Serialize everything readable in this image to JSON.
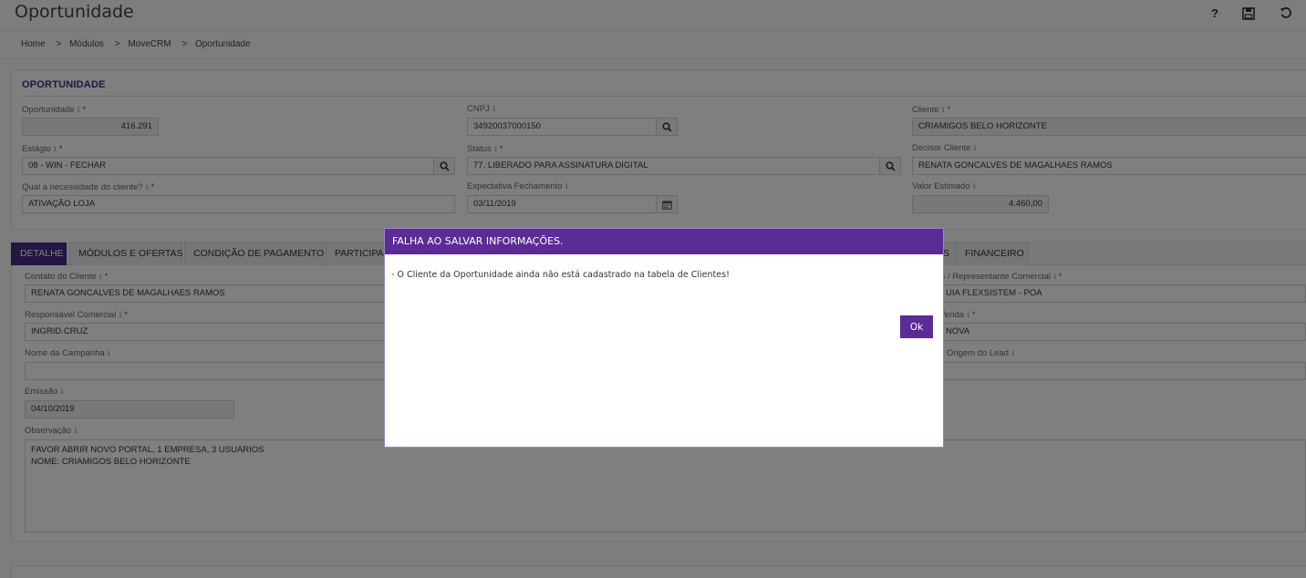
{
  "header": {
    "title": "Oportunidade",
    "help_label": "?"
  },
  "breadcrumb": {
    "items": [
      "Home",
      "Módulos",
      "MoveCRM",
      "Oportunidade"
    ],
    "separator": ">"
  },
  "section": {
    "title": "OPORTUNIDADE"
  },
  "info_glyph": "ℹ",
  "required_glyph": "*",
  "fields": {
    "oportunidade": {
      "label": "Oportunidade",
      "value": "416.291"
    },
    "cnpj": {
      "label": "CNPJ",
      "value": "34920037000150"
    },
    "cliente": {
      "label": "Cliente",
      "value": "CRIAMIGOS BELO HORIZONTE"
    },
    "estagio": {
      "label": "Estágio",
      "value": "08 - WIN - FECHAR"
    },
    "status": {
      "label": "Status",
      "value": "77. LIBERADO PARA ASSINATURA DIGITAL"
    },
    "decisor": {
      "label": "Decisor Cliente",
      "value": "RENATA GONCALVES DE MAGALHAES RAMOS"
    },
    "necessidade": {
      "label": "Qual a necessidade do cliente?",
      "value": "ATIVAÇÃO LOJA"
    },
    "expectativa": {
      "label": "Expectativa Fechamento",
      "value": "03/11/2019"
    },
    "valor": {
      "label": "Valor Estimado",
      "value": "4.460,00"
    }
  },
  "tabs": [
    {
      "label": "DETALHE"
    },
    {
      "label": "MÓDULOS E OFERTAS"
    },
    {
      "label": "CONDIÇÃO DE PAGAMENTO"
    },
    {
      "label": "PARTICIPAN"
    },
    {
      "label": "S"
    },
    {
      "label": "FINANCEIRO"
    }
  ],
  "detail": {
    "contato": {
      "label": "Contato do Cliente",
      "value": "RENATA GONCALVES DE MAGALHAES RAMOS"
    },
    "representante": {
      "label": "S / Representante Comercial",
      "value": "UIA FLEXSISTEM - POA"
    },
    "responsavel": {
      "label": "Responsável Comercial",
      "value": "INGRID.CRUZ"
    },
    "venda": {
      "label": "Venda",
      "value": "NOVA"
    },
    "campanha": {
      "label": "Nome da Campanha",
      "value": ""
    },
    "origem": {
      "label": "e Origem do Lead",
      "value": ""
    },
    "emissao": {
      "label": "Emissão",
      "value": "04/10/2019"
    },
    "observacao": {
      "label": "Observação",
      "value": "FAVOR ABRIR NOVO PORTAL, 1 EMPRESA, 3 USUARIOS\nNOME: CRIAMIGOS BELO HORIZONTE"
    }
  },
  "modal": {
    "title": "FALHA AO SALVAR INFORMAÇÕES.",
    "message": "- O Cliente da Oportunidade ainda não está cadastrado na tabela de Clientes!",
    "ok_label": "Ok"
  },
  "colors": {
    "accent": "#5b2b96",
    "section_title": "#4b2a86"
  }
}
